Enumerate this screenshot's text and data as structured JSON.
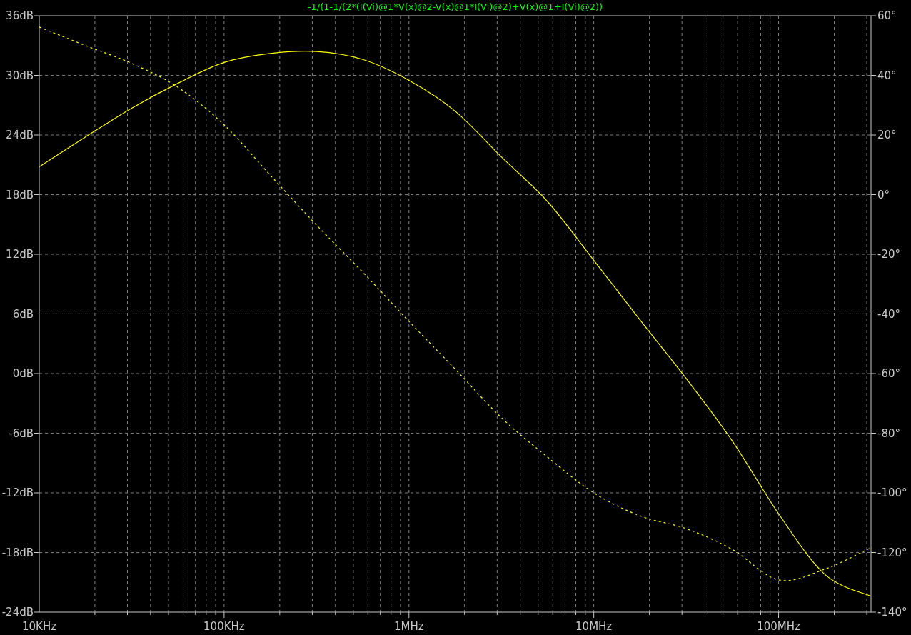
{
  "plot": {
    "chart_data": {
      "type": "line",
      "grid": true,
      "title": "-1/(1-1/(2*(I(Vi)@1*V(x)@2-V(x)@1*I(Vi)@2)+V(x)@1+I(Vi)@2))",
      "categories": [
        "10KHz",
        null,
        null,
        null,
        "100KHz",
        null,
        null,
        null,
        "1MHz",
        null,
        null,
        null,
        "10MHz",
        null,
        null,
        null,
        "100MHz",
        null,
        null
      ],
      "ylim": [
        -24,
        36
      ],
      "yticks": [
        {
          "value": 36,
          "label": "36dB"
        },
        {
          "value": 30,
          "label": "30dB"
        },
        {
          "value": 24,
          "label": "24dB"
        },
        {
          "value": 18,
          "label": "18dB"
        },
        {
          "value": 12,
          "label": "12dB"
        },
        {
          "value": 6,
          "label": "6dB"
        },
        {
          "value": 0,
          "label": "0dB"
        },
        {
          "value": -6,
          "label": "-6dB"
        },
        {
          "value": -12,
          "label": "-12dB"
        },
        {
          "value": -18,
          "label": "-18dB"
        },
        {
          "value": -24,
          "label": "-24dB"
        }
      ],
      "y2lim": [
        -140,
        60
      ],
      "y2ticks": [
        {
          "value": 60,
          "label": "60°"
        },
        {
          "value": 40,
          "label": "40°"
        },
        {
          "value": 20,
          "label": "20°"
        },
        {
          "value": 0,
          "label": "0°"
        },
        {
          "value": -20,
          "label": "-20°"
        },
        {
          "value": -40,
          "label": "-40°"
        },
        {
          "value": -60,
          "label": "-60°"
        },
        {
          "value": -80,
          "label": "-80°"
        },
        {
          "value": -100,
          "label": "-100°"
        },
        {
          "value": -120,
          "label": "-120°"
        },
        {
          "value": -140,
          "label": "-140°"
        }
      ],
      "series": [
        {
          "color": "#ffff00",
          "line_style": "solid",
          "values": [
            20.8,
            23.8,
            26.7,
            29.2,
            31.3,
            32.2,
            32.4,
            31.6,
            29.5,
            26.4,
            21.8,
            17.3,
            11.4,
            5.4,
            -0.5,
            -6.8,
            -14.1,
            -20.2,
            -22.4
          ]
        },
        {
          "color": "#ffff00",
          "axis": "y2",
          "line_style": "dashed",
          "values": [
            56.2,
            50.0,
            44.0,
            36.0,
            23.4,
            6.5,
            -10.2,
            -26.0,
            -42.5,
            -58.5,
            -74.8,
            -88.0,
            -100.0,
            -107.7,
            -112.0,
            -119.0,
            -129.2,
            -125.6,
            -118.4
          ]
        }
      ]
    }
  }
}
